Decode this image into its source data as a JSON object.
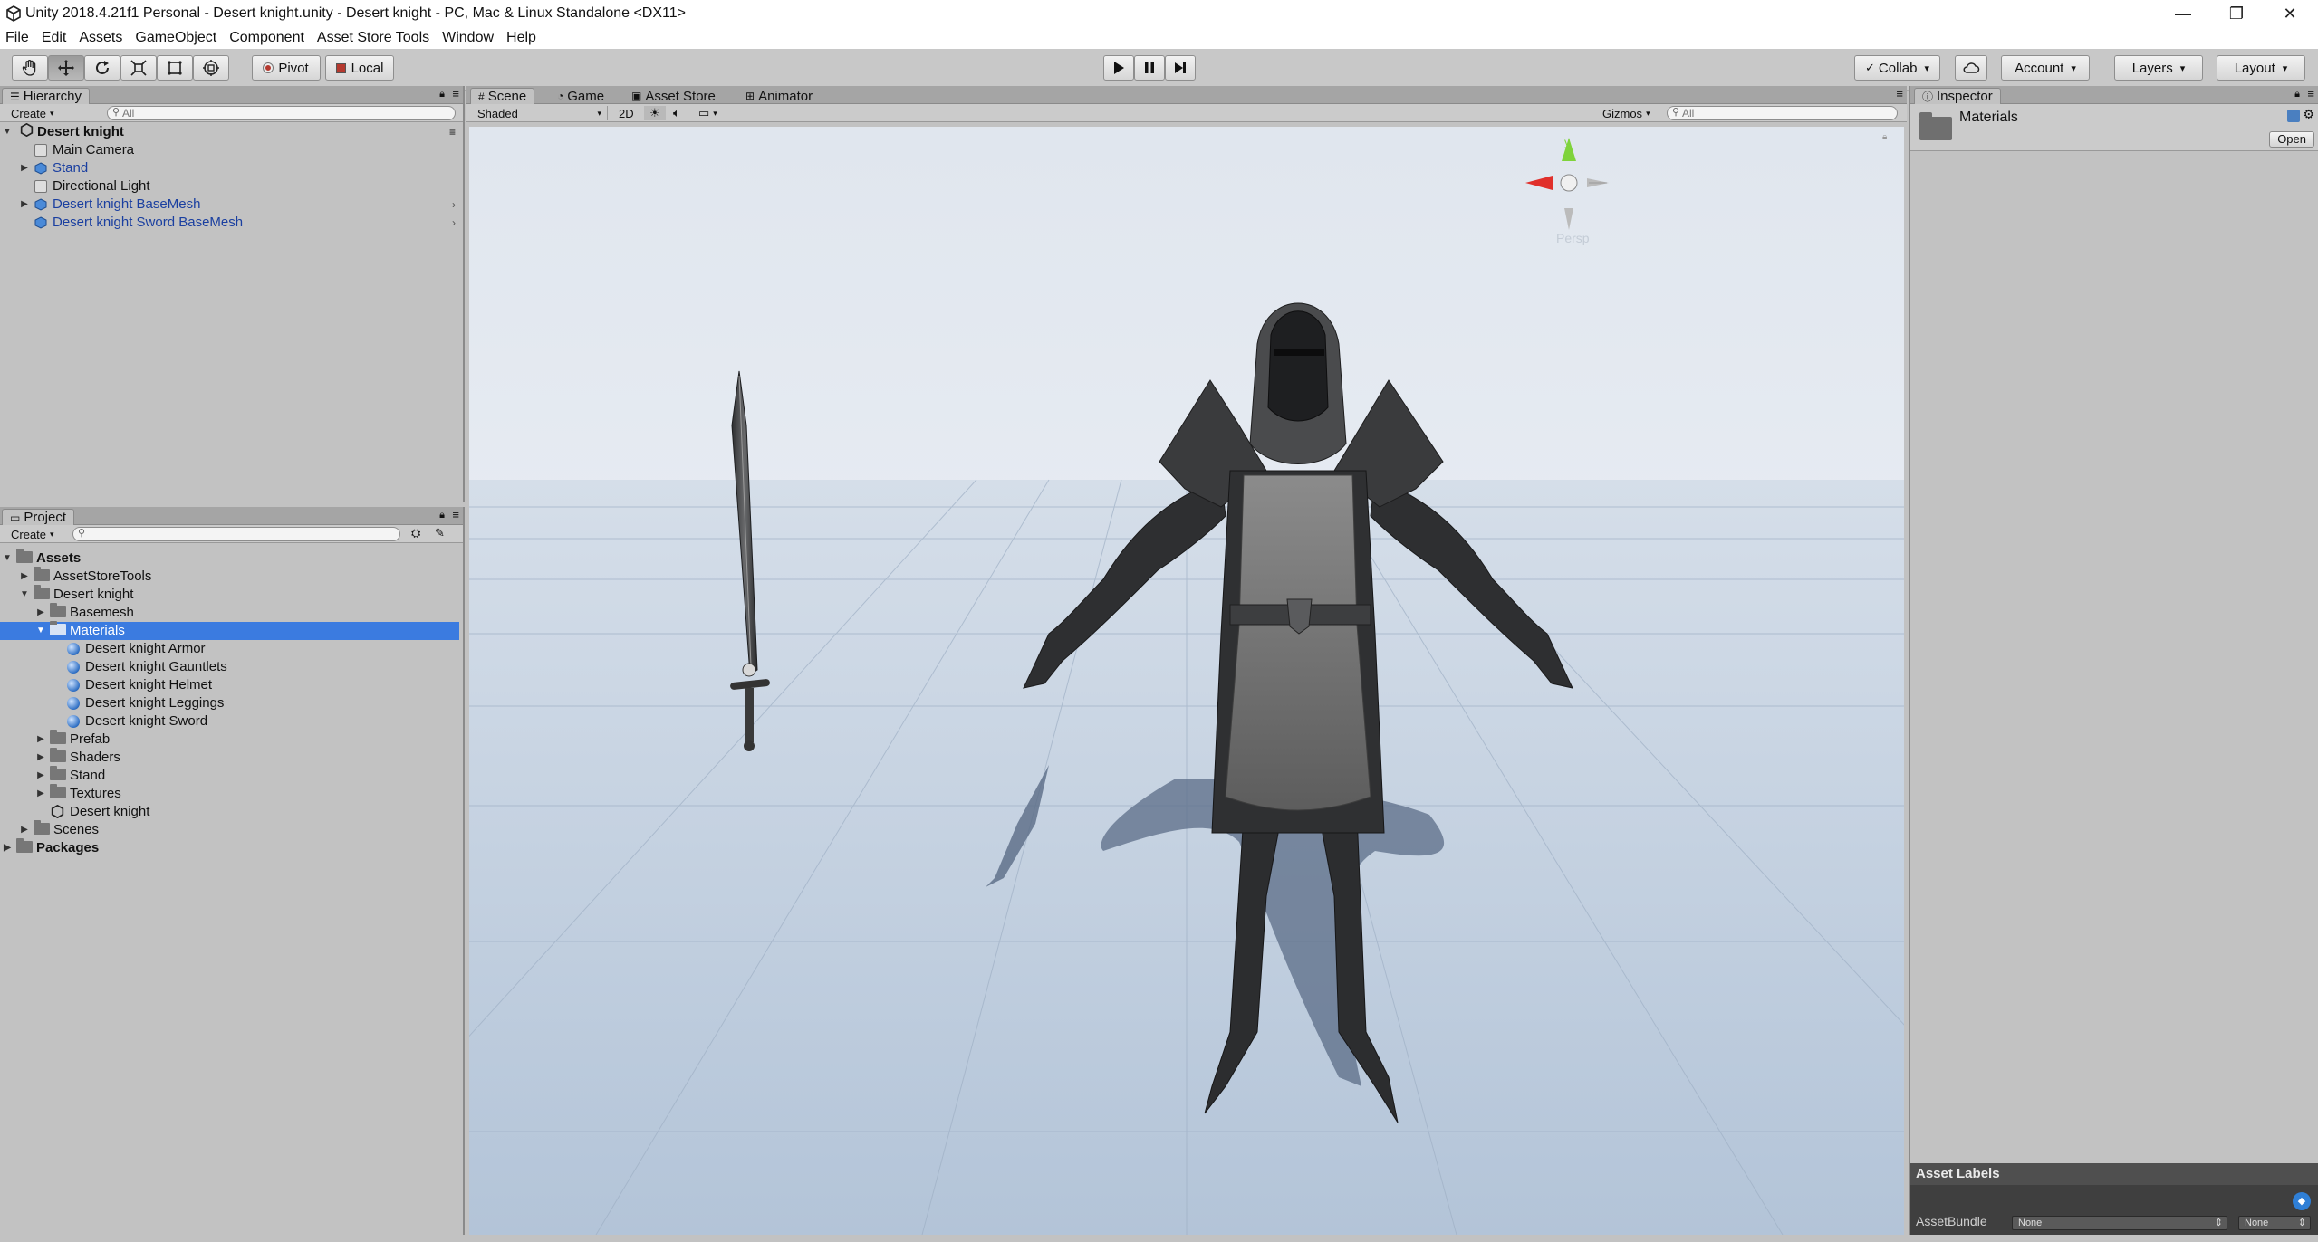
{
  "window": {
    "title": "Unity 2018.4.21f1 Personal - Desert knight.unity - Desert knight - PC, Mac & Linux Standalone <DX11>",
    "minimize": "—",
    "maximize": "❐",
    "close": "✕"
  },
  "menu": [
    "File",
    "Edit",
    "Assets",
    "GameObject",
    "Component",
    "Asset Store Tools",
    "Window",
    "Help"
  ],
  "toolbar": {
    "pivot": "Pivot",
    "local": "Local",
    "collab": "Collab",
    "account": "Account",
    "layers": "Layers",
    "layout": "Layout"
  },
  "hierarchy": {
    "tab": "Hierarchy",
    "create": "Create",
    "search_placeholder": "All",
    "scene_name": "Desert knight",
    "items": [
      {
        "label": "Main Camera",
        "prefab": false,
        "expandable": false
      },
      {
        "label": "Stand",
        "prefab": true,
        "expandable": true
      },
      {
        "label": "Directional Light",
        "prefab": false,
        "expandable": false
      },
      {
        "label": "Desert knight BaseMesh",
        "prefab": true,
        "expandable": true
      },
      {
        "label": "Desert knight Sword BaseMesh",
        "prefab": true,
        "expandable": false
      }
    ]
  },
  "project": {
    "tab": "Project",
    "create": "Create",
    "tree": {
      "assets": "Assets",
      "asset_store_tools": "AssetStoreTools",
      "desert_knight": "Desert knight",
      "basemesh": "Basemesh",
      "materials": "Materials",
      "mat_armor": "Desert knight Armor",
      "mat_gauntlets": "Desert knight Gauntlets",
      "mat_helmet": "Desert knight Helmet",
      "mat_leggings": "Desert knight Leggings",
      "mat_sword": "Desert knight Sword",
      "prefab": "Prefab",
      "shaders": "Shaders",
      "stand": "Stand",
      "textures": "Textures",
      "scene_file": "Desert knight",
      "scenes": "Scenes",
      "packages": "Packages"
    }
  },
  "scene": {
    "tabs": [
      "Scene",
      "Game",
      "Asset Store",
      "Animator"
    ],
    "shading": "Shaded",
    "mode_2d": "2D",
    "gizmos": "Gizmos",
    "search_placeholder": "All",
    "persp": "Persp",
    "gizmo_y": "y"
  },
  "inspector": {
    "tab": "Inspector",
    "selected": "Materials",
    "open": "Open",
    "asset_labels": "Asset Labels",
    "asset_bundle": "AssetBundle",
    "bundle_value": "None",
    "variant_value": "None"
  }
}
